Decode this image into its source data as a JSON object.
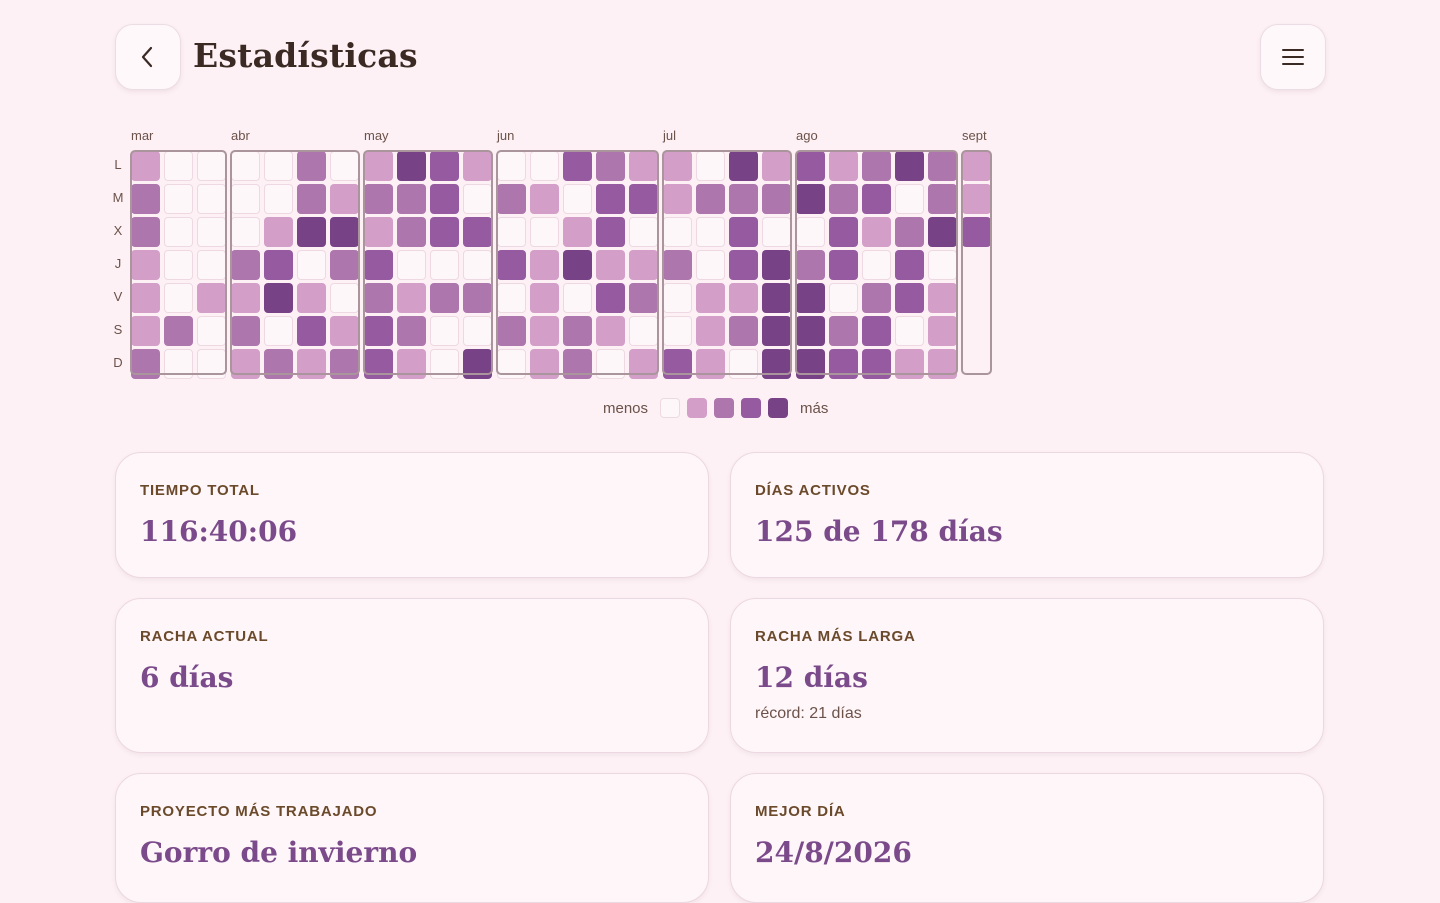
{
  "header": {
    "title": "Estadísticas",
    "back_icon": "chevron-left-icon",
    "menu_icon": "hamburger-menu-icon"
  },
  "heatmap": {
    "day_labels": [
      "L",
      "M",
      "X",
      "J",
      "V",
      "S",
      "D"
    ],
    "months": [
      {
        "label": "mar",
        "weeks": [
          [
            1,
            2,
            2,
            1,
            1,
            1,
            2
          ],
          [
            0,
            0,
            0,
            0,
            0,
            2,
            0
          ],
          [
            0,
            0,
            0,
            0,
            1,
            0,
            0
          ]
        ]
      },
      {
        "label": "abr",
        "weeks": [
          [
            0,
            0,
            0,
            2,
            1,
            2,
            1
          ],
          [
            0,
            0,
            1,
            3,
            4,
            0,
            2
          ],
          [
            2,
            2,
            4,
            0,
            1,
            3,
            1
          ],
          [
            0,
            1,
            4,
            2,
            0,
            1,
            2
          ]
        ]
      },
      {
        "label": "may",
        "weeks": [
          [
            1,
            2,
            1,
            3,
            2,
            3,
            3
          ],
          [
            4,
            2,
            2,
            0,
            1,
            2,
            1
          ],
          [
            3,
            3,
            3,
            0,
            2,
            0,
            0
          ],
          [
            1,
            0,
            3,
            0,
            2,
            0,
            4
          ]
        ]
      },
      {
        "label": "jun",
        "weeks": [
          [
            0,
            2,
            0,
            3,
            0,
            2,
            0
          ],
          [
            0,
            1,
            0,
            1,
            1,
            1,
            1
          ],
          [
            3,
            0,
            1,
            4,
            0,
            2,
            2
          ],
          [
            2,
            3,
            3,
            1,
            3,
            1,
            0
          ],
          [
            1,
            3,
            0,
            1,
            2,
            0,
            1
          ]
        ]
      },
      {
        "label": "jul",
        "weeks": [
          [
            1,
            1,
            0,
            2,
            0,
            0,
            3
          ],
          [
            0,
            2,
            0,
            0,
            1,
            1,
            1
          ],
          [
            4,
            2,
            3,
            3,
            1,
            2,
            0
          ],
          [
            1,
            2,
            0,
            4,
            4,
            4,
            4
          ]
        ]
      },
      {
        "label": "ago",
        "weeks": [
          [
            3,
            4,
            0,
            2,
            4,
            4,
            4
          ],
          [
            1,
            2,
            3,
            3,
            0,
            2,
            3
          ],
          [
            2,
            3,
            1,
            0,
            2,
            3,
            3
          ],
          [
            4,
            0,
            2,
            3,
            3,
            0,
            1
          ],
          [
            2,
            2,
            4,
            0,
            1,
            1,
            1
          ]
        ]
      },
      {
        "label": "sept",
        "weeks": [
          [
            1,
            1,
            3
          ]
        ]
      }
    ],
    "legend": {
      "less": "menos",
      "more": "más"
    },
    "colors": {
      "lvl0": "#fef7fa",
      "lvl1": "#d39ec8",
      "lvl2": "#ad76ad",
      "lvl3": "#955aa0",
      "lvl4": "#774286"
    }
  },
  "cards": {
    "total_time": {
      "label": "TIEMPO TOTAL",
      "value": "116:40:06"
    },
    "active_days": {
      "label": "DÍAS ACTIVOS",
      "value": "125 de 178 días"
    },
    "current_streak": {
      "label": "RACHA ACTUAL",
      "value": "6 días"
    },
    "longest_streak": {
      "label": "RACHA MÁS LARGA",
      "value": "12 días",
      "sub": "récord: 21 días"
    },
    "top_project": {
      "label": "PROYECTO MÁS TRABAJADO",
      "value": "Gorro de invierno"
    },
    "best_day": {
      "label": "MEJOR DÍA",
      "value": "24/8/2026"
    }
  }
}
